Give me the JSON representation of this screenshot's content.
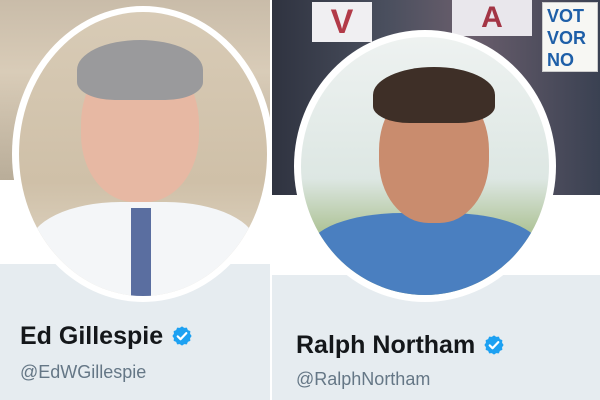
{
  "profiles": [
    {
      "name": "Ed Gillespie",
      "handle": "@EdWGillespie",
      "verified_icon": "verified-badge-icon",
      "colors": {
        "verified": "#1da1f2",
        "name": "#14171a",
        "handle": "#657786",
        "strip": "#e6ecf0"
      }
    },
    {
      "name": "Ralph Northam",
      "handle": "@RalphNortham",
      "verified_icon": "verified-badge-icon",
      "banner_signs": [
        "V",
        "A",
        "VOT",
        "VOR",
        "NO"
      ],
      "colors": {
        "verified": "#1da1f2",
        "name": "#14171a",
        "handle": "#657786",
        "strip": "#e6ecf0"
      }
    }
  ]
}
